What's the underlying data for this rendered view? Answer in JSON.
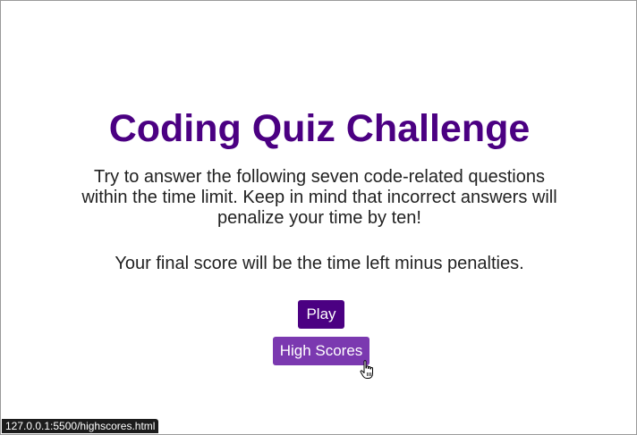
{
  "page": {
    "title": "Coding Quiz Challenge",
    "intro": "Try to answer the following seven code-related questions within the time limit. Keep in mind that incorrect answers will penalize your time by ten!",
    "final_note": "Your final score will be the time left minus penalties."
  },
  "buttons": {
    "play_label": "Play",
    "high_scores_label": "High Scores"
  },
  "status_bar": {
    "link_url": "127.0.0.1:5500/highscores.html"
  },
  "colors": {
    "title": "#4b0082",
    "play_button": "#4b0082",
    "high_scores_button_hover": "#7b39b0",
    "body_text": "#222222",
    "background": "#ffffff"
  },
  "icons": {
    "cursor": "pointer-hand-icon"
  }
}
